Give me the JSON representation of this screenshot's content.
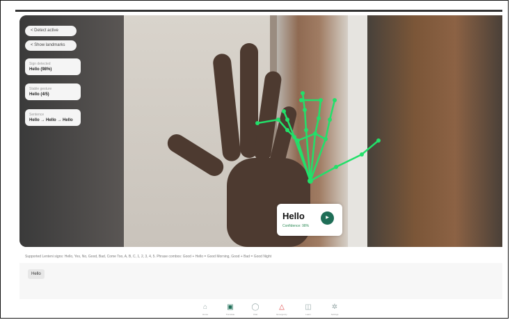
{
  "left_panel": {
    "buttons": [
      "< Detect active",
      "< Show landmarks"
    ],
    "cards": [
      {
        "label": "Sign detected",
        "value": "Hello (98%)"
      },
      {
        "label": "Stable gesture",
        "value": "Hello (4/5)"
      },
      {
        "label": "Sentence",
        "value": "Hello → Hello → Hello"
      }
    ]
  },
  "prediction": {
    "word": "Hello",
    "confidence": "Confidence: 98%",
    "speak_label": "▶"
  },
  "info_text": "Supported Lenteni signs: Hello, Yes, No, Good, Bad, Come Too, A, B, C, 1, 2, 3, 4, 5. Phrase combos: Good + Hello = Good Morning, Good + Bad = Good Night",
  "sentence": {
    "chip": "Hello"
  },
  "nav": [
    {
      "name": "home",
      "icon": "⌂",
      "label": "Home"
    },
    {
      "name": "camera",
      "icon": "▣",
      "label": "Translate"
    },
    {
      "name": "chat",
      "icon": "◯",
      "label": "Chat"
    },
    {
      "name": "alert",
      "icon": "△",
      "label": "Emergency"
    },
    {
      "name": "book",
      "icon": "◫",
      "label": "Learn"
    },
    {
      "name": "settings",
      "icon": "✲",
      "label": "Settings"
    }
  ],
  "colors": {
    "accent": "#1f6e57",
    "landmarks": "#22e06a"
  }
}
